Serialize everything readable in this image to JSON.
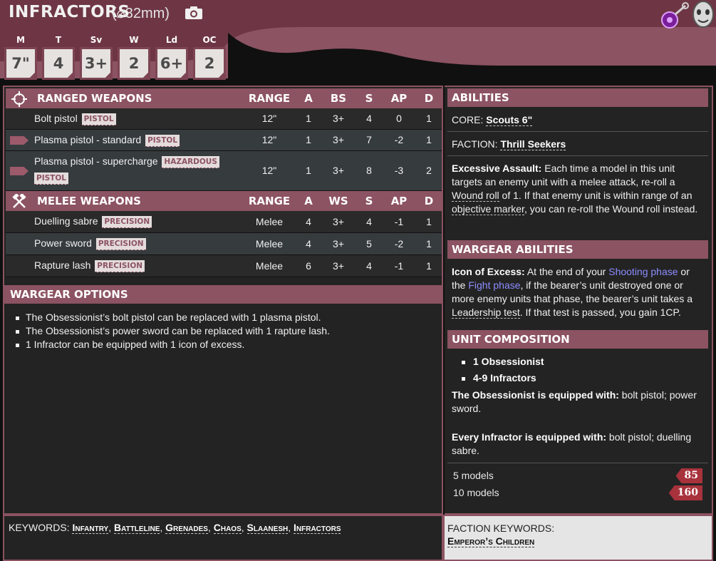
{
  "header": {
    "unit_name": "INFRACTORS",
    "base_size": "(⌀32mm)",
    "stats": [
      {
        "label": "M",
        "value": "7\""
      },
      {
        "label": "T",
        "value": "4"
      },
      {
        "label": "Sv",
        "value": "3+"
      },
      {
        "label": "W",
        "value": "2"
      },
      {
        "label": "Ld",
        "value": "6+"
      },
      {
        "label": "OC",
        "value": "2"
      }
    ]
  },
  "ranged": {
    "title": "RANGED WEAPONS",
    "cols": [
      "RANGE",
      "A",
      "BS",
      "S",
      "AP",
      "D"
    ],
    "rows": [
      {
        "name": "Bolt pistol",
        "tags": [
          "PISTOL"
        ],
        "range": "12\"",
        "a": "1",
        "bs": "3+",
        "s": "4",
        "ap": "0",
        "d": "1"
      },
      {
        "name": "Plasma pistol - standard",
        "tags": [
          "PISTOL"
        ],
        "range": "12\"",
        "a": "1",
        "bs": "3+",
        "s": "7",
        "ap": "-2",
        "d": "1"
      },
      {
        "name": "Plasma pistol - supercharge",
        "tags": [
          "HAZARDOUS",
          "PISTOL"
        ],
        "range": "12\"",
        "a": "1",
        "bs": "3+",
        "s": "8",
        "ap": "-3",
        "d": "2"
      }
    ]
  },
  "melee": {
    "title": "MELEE WEAPONS",
    "cols": [
      "RANGE",
      "A",
      "WS",
      "S",
      "AP",
      "D"
    ],
    "rows": [
      {
        "name": "Duelling sabre",
        "tags": [
          "PRECISION"
        ],
        "range": "Melee",
        "a": "4",
        "ws": "3+",
        "s": "4",
        "ap": "-1",
        "d": "1"
      },
      {
        "name": "Power sword",
        "tags": [
          "PRECISION"
        ],
        "range": "Melee",
        "a": "4",
        "ws": "3+",
        "s": "5",
        "ap": "-2",
        "d": "1"
      },
      {
        "name": "Rapture lash",
        "tags": [
          "PRECISION"
        ],
        "range": "Melee",
        "a": "6",
        "ws": "3+",
        "s": "4",
        "ap": "-1",
        "d": "1"
      }
    ]
  },
  "wargear_options": {
    "title": "WARGEAR OPTIONS",
    "items": [
      "The Obsessionist’s bolt pistol can be replaced with 1 plasma pistol.",
      "The Obsessionist’s power sword can be replaced with 1 rapture lash.",
      "1 Infractor can be equipped with 1 icon of excess."
    ]
  },
  "abilities": {
    "title": "ABILITIES",
    "core_label": "CORE:",
    "core_value": "Scouts 6\"",
    "faction_label": "FACTION:",
    "faction_value": "Thrill Seekers",
    "rule_name": "Excessive Assault:",
    "rule_text_1": " Each time a model in this unit targets an enemy unit with a melee attack, re-roll a ",
    "rule_link_1": "Wound roll",
    "rule_text_2": " of 1. If that enemy unit is within range of an ",
    "rule_link_2": "objective marker",
    "rule_text_3": ", you can re-roll the Wound roll instead."
  },
  "wargear_abilities": {
    "title": "WARGEAR ABILITIES",
    "name": "Icon of Excess:",
    "t1": " At the end of your ",
    "l1": "Shooting phase",
    "t2": " or the ",
    "l2": "Fight phase",
    "t3": ", if the bearer’s unit destroyed one or more enemy units that phase, the bearer’s unit takes a ",
    "l3": "Leadership test",
    "t4": ". If that test is passed, you gain 1CP."
  },
  "unit_composition": {
    "title": "UNIT COMPOSITION",
    "items": [
      "1 Obsessionist",
      "4-9 Infractors"
    ],
    "eq1_label": "The Obsessionist is equipped with:",
    "eq1_text": " bolt pistol; power sword.",
    "eq2_label": "Every Infractor is equipped with:",
    "eq2_text": " bolt pistol; duelling sabre.",
    "costs": [
      {
        "models": "5 models",
        "points": "85"
      },
      {
        "models": "10 models",
        "points": "160"
      }
    ]
  },
  "keywords": {
    "label": "KEYWORDS: ",
    "items": [
      "Infantry",
      "Battleline",
      "Grenades",
      "Chaos",
      "Slaanesh",
      "Infractors"
    ]
  },
  "faction_keywords": {
    "label": "FACTION KEYWORDS:",
    "items": [
      "Emperor’s Children"
    ]
  },
  "icons": [
    "camera-icon",
    "crosshair-icon",
    "crossed-hammers-icon",
    "slaanesh-faction-icon",
    "chaos-mark-icon"
  ],
  "colors": {
    "accent": "#8c5362",
    "panel": "#232323",
    "points": "#a8323c",
    "link": "#8d8cff"
  }
}
